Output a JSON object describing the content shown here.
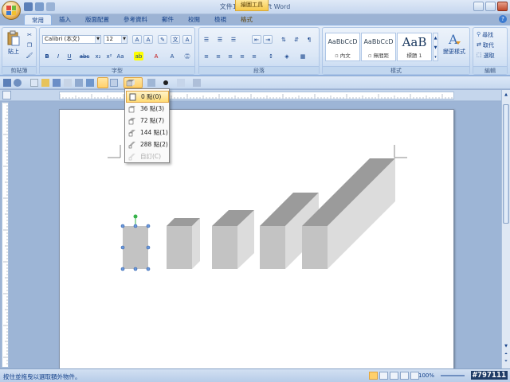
{
  "window": {
    "title": "文件1 - Microsoft Word",
    "context_tab": "繪圖工具"
  },
  "tabs": [
    {
      "label": "常用"
    },
    {
      "label": "插入"
    },
    {
      "label": "版面配置"
    },
    {
      "label": "參考資料"
    },
    {
      "label": "郵件"
    },
    {
      "label": "校閱"
    },
    {
      "label": "檢視"
    },
    {
      "label": "格式"
    }
  ],
  "ribbon": {
    "clipboard": {
      "paste_label": "貼上",
      "group_label": "剪貼簿"
    },
    "font": {
      "font_name": "Calibri (本文)",
      "font_size": "12",
      "group_label": "字型"
    },
    "paragraph": {
      "group_label": "段落"
    },
    "styles": {
      "group_label": "樣式",
      "items": [
        {
          "sample": "AaBbCcD",
          "name": "▫ 內文"
        },
        {
          "sample": "AaBbCcD",
          "name": "▫ 無間距"
        },
        {
          "sample": "AaB",
          "name": "標題 1"
        }
      ],
      "change_styles_label": "變更樣式"
    },
    "editing": {
      "group_label": "編輯",
      "items": [
        "尋找",
        "取代",
        "選取"
      ]
    }
  },
  "depth_menu": {
    "items": [
      {
        "label": "0 點(0)",
        "active": true,
        "disabled": false
      },
      {
        "label": "36 點(3)",
        "active": false,
        "disabled": false
      },
      {
        "label": "72 點(7)",
        "active": false,
        "disabled": false
      },
      {
        "label": "144 點(1)",
        "active": false,
        "disabled": false
      },
      {
        "label": "288 點(2)",
        "active": false,
        "disabled": false
      },
      {
        "label": "自訂(C)",
        "active": false,
        "disabled": true
      }
    ]
  },
  "statusbar": {
    "text": "按住並拖曳以選取額外物件。",
    "zoom": "100%",
    "watermark": "#797111"
  },
  "colors": {
    "shape_front": "#c3c3c3",
    "shape_top": "#9b9b9b",
    "shape_side": "#dcdcdc",
    "selection_handle": "#4a7ecb",
    "rotation_handle": "#36b34a"
  }
}
